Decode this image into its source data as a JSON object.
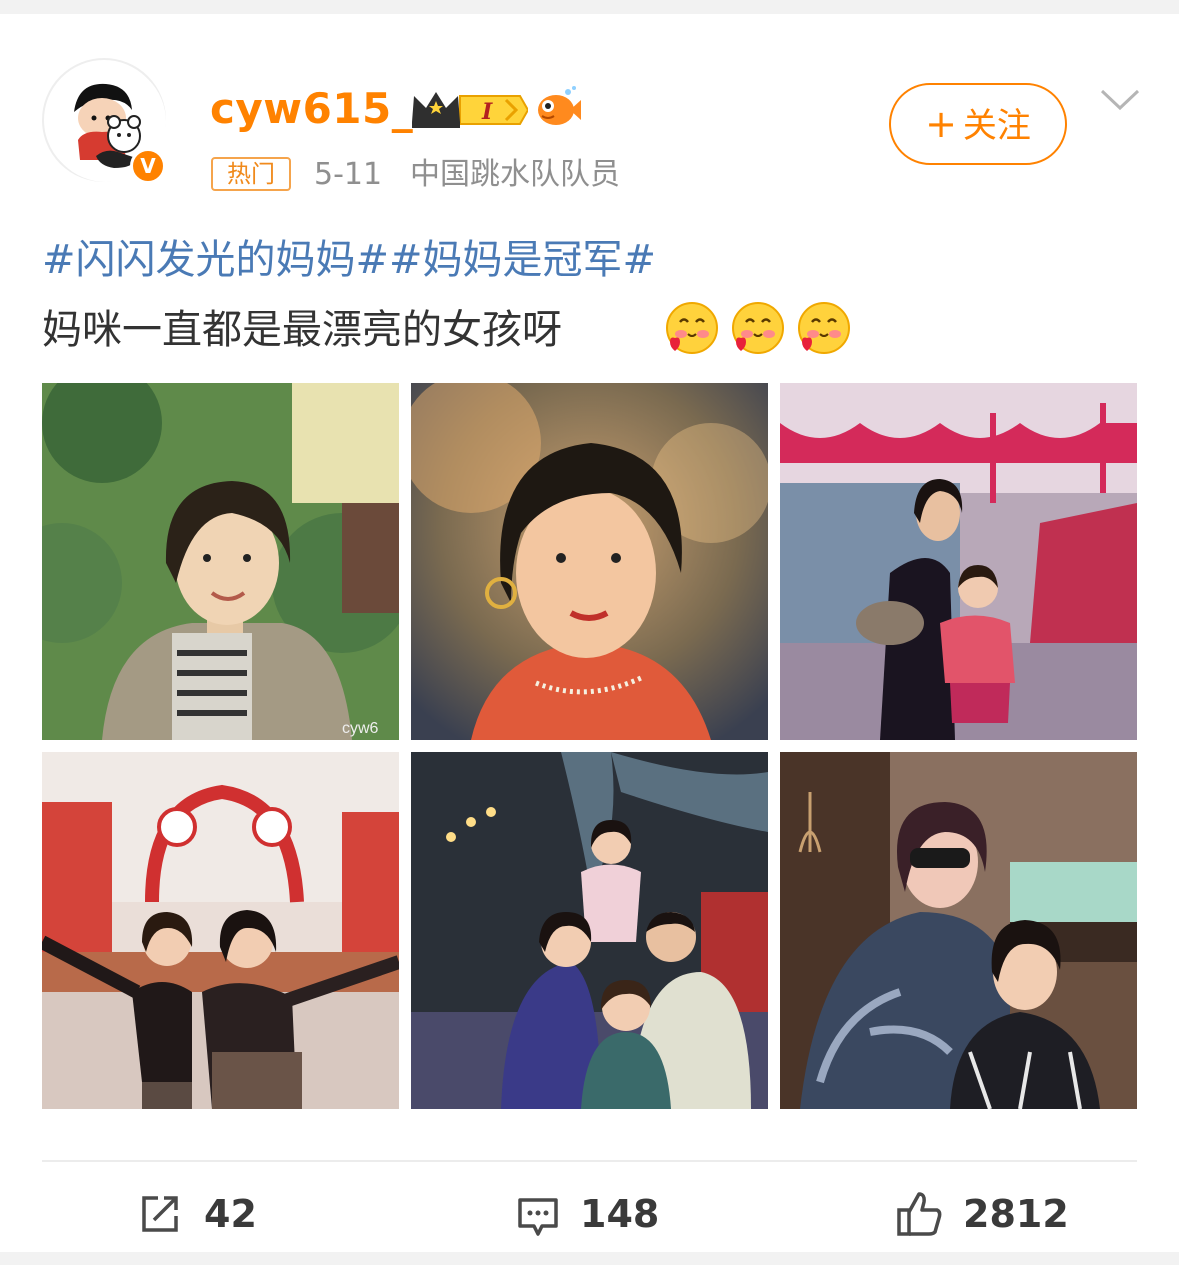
{
  "post": {
    "username": "cyw615_",
    "verified_badge": "V",
    "level_badge": "I",
    "hot_tag": "热门",
    "date": "5-11",
    "source": "中国跳水队队员",
    "follow_label": "关注",
    "follow_plus": "+",
    "hashtags": "#闪闪发光的妈妈##妈妈是冠军#",
    "body": "妈咪一直都是最漂亮的女孩呀",
    "emoji_icons": [
      "love-face-emoji",
      "love-face-emoji",
      "love-face-emoji"
    ]
  },
  "photos": [
    {
      "name": "photo-1",
      "watermark": "cyw6"
    },
    {
      "name": "photo-2",
      "watermark": ""
    },
    {
      "name": "photo-3",
      "watermark": ""
    },
    {
      "name": "photo-4",
      "watermark": ""
    },
    {
      "name": "photo-5",
      "watermark": ""
    },
    {
      "name": "photo-6",
      "watermark": ""
    }
  ],
  "actions": {
    "repost_count": "42",
    "comment_count": "148",
    "like_count": "2812"
  },
  "colors": {
    "accent": "#ff8200",
    "hashtag": "#4a7ab5",
    "meta": "#8f8f8f"
  }
}
